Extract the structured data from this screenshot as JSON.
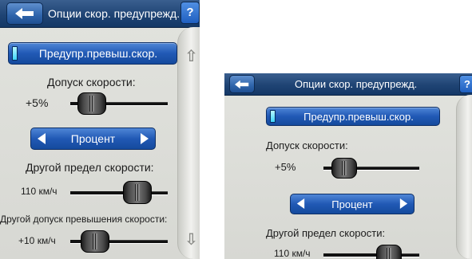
{
  "screens": [
    {
      "header": {
        "title": "Опции скор. предупрежд.",
        "back_icon": "back-arrow-icon",
        "help_label": "?"
      },
      "warning_toggle": {
        "label": "Предупр.превыш.скор.",
        "state": "on"
      },
      "speed_tolerance": {
        "label": "Допуск скорости:",
        "value": "+5%",
        "slider_position": 0.12
      },
      "unit_selector": {
        "label": "Процент"
      },
      "other_limit": {
        "label": "Другой предел скорости:",
        "value": "110 км/ч",
        "slider_position": 0.55
      },
      "other_tolerance": {
        "label": "Другой допуск превышения скорости:",
        "value": "+10 км/ч",
        "slider_position": 0.2
      },
      "scroll": {
        "up_icon": "scroll-up-arrow-icon",
        "down_icon": "scroll-down-arrow-icon"
      }
    },
    {
      "header": {
        "title": "Опции скор. предупрежд.",
        "back_icon": "back-arrow-icon",
        "help_label": "?"
      },
      "warning_toggle": {
        "label": "Предупр.превыш.скор.",
        "state": "on"
      },
      "speed_tolerance": {
        "label": "Допуск скорости:",
        "value": "+5%",
        "slider_position": 0.12
      },
      "unit_selector": {
        "label": "Процент"
      },
      "other_limit": {
        "label": "Другой предел скорости:",
        "value": "110 км/ч",
        "slider_position": 0.58
      }
    }
  ],
  "colors": {
    "header_bg": "#1f4474",
    "button_blue": "#2159b5",
    "panel_bg": "#dcddd8",
    "led_on": "#3fd6ff"
  }
}
